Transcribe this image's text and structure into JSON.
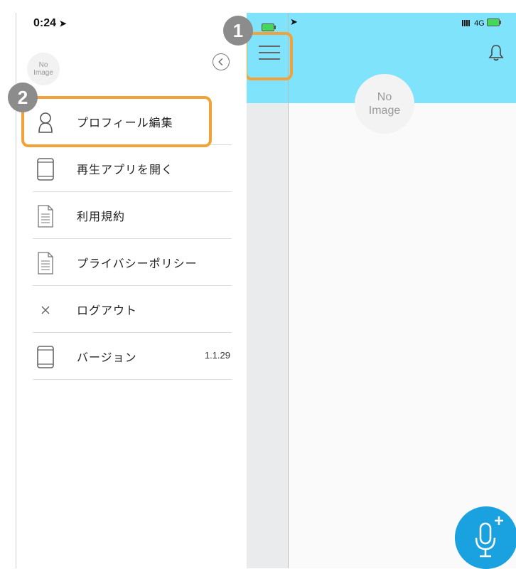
{
  "status_bar": {
    "time": "0:24",
    "network": "4G"
  },
  "drawer": {
    "avatar_text": "No\nImage",
    "menu": [
      {
        "label": "プロフィール編集",
        "icon": "person-icon"
      },
      {
        "label": "再生アプリを開く",
        "icon": "tablet-icon"
      },
      {
        "label": "利用規約",
        "icon": "document-icon"
      },
      {
        "label": "プライバシーポリシー",
        "icon": "document-icon"
      },
      {
        "label": "ログアウト",
        "icon": "close-icon"
      },
      {
        "label": "バージョン",
        "icon": "tablet-icon",
        "value": "1.1.29"
      }
    ]
  },
  "main": {
    "avatar_text": "No\nImage",
    "header_color": "#7fe3fb",
    "accent_color": "#1aa2e0"
  },
  "annotations": {
    "badge_1": "1",
    "badge_2": "2",
    "highlight_color": "#f3a23a"
  }
}
